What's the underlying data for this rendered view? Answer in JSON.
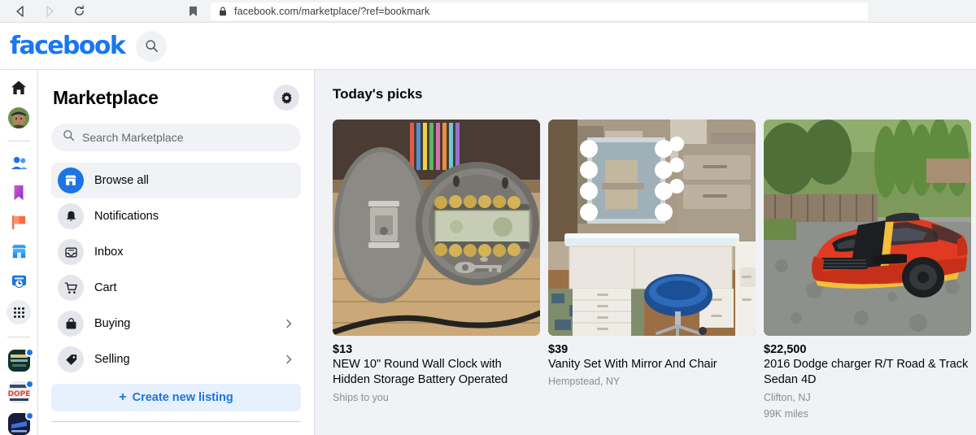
{
  "browser": {
    "back_icon": "back-arrow-icon",
    "forward_icon": "forward-arrow-icon",
    "reload_icon": "reload-icon",
    "bookmark_icon": "bookmark-icon",
    "lock_icon": "lock-icon",
    "url": "facebook.com/marketplace/?ref=bookmark"
  },
  "header": {
    "logo": "facebook",
    "logo_color": "#1877f2",
    "search_icon": "search-icon"
  },
  "rail": {
    "items": [
      {
        "name": "home",
        "icon": "home-icon"
      },
      {
        "name": "profile",
        "icon": "avatar-icon"
      },
      {
        "name": "friends",
        "icon": "friends-icon"
      },
      {
        "name": "saved",
        "icon": "bookmark-saved-icon"
      },
      {
        "name": "pages",
        "icon": "flag-pages-icon"
      },
      {
        "name": "marketplace",
        "icon": "marketplace-store-icon"
      },
      {
        "name": "memories",
        "icon": "memories-clock-icon"
      },
      {
        "name": "see-more",
        "icon": "grid-menu-icon"
      }
    ],
    "groups": [
      {
        "name": "group-1"
      },
      {
        "name": "group-2"
      },
      {
        "name": "group-3"
      }
    ]
  },
  "sidebar": {
    "title": "Marketplace",
    "settings_icon": "gear-icon",
    "search": {
      "placeholder": "Search Marketplace",
      "value": "",
      "icon": "search-icon"
    },
    "nav": [
      {
        "label": "Browse all",
        "icon": "store-icon",
        "active": true,
        "chevron": false
      },
      {
        "label": "Notifications",
        "icon": "bell-icon",
        "active": false,
        "chevron": false
      },
      {
        "label": "Inbox",
        "icon": "inbox-icon",
        "active": false,
        "chevron": false
      },
      {
        "label": "Cart",
        "icon": "cart-icon",
        "active": false,
        "chevron": false
      },
      {
        "label": "Buying",
        "icon": "bag-icon",
        "active": false,
        "chevron": true
      },
      {
        "label": "Selling",
        "icon": "tag-icon",
        "active": false,
        "chevron": true
      }
    ],
    "create_listing": {
      "label": "Create new listing",
      "plus": "+",
      "color": "#1b74e4"
    }
  },
  "main": {
    "section_title": "Today's picks",
    "listings": [
      {
        "price": "$13",
        "title": "NEW 10\" Round Wall Clock with Hidden Storage Battery Operated",
        "meta1": "Ships to you",
        "meta2": "",
        "image": "wall-clock-hidden-safe-photo"
      },
      {
        "price": "$39",
        "title": "Vanity Set With Mirror And Chair",
        "meta1": "Hempstead, NY",
        "meta2": "",
        "image": "vanity-set-mirror-chair-photo"
      },
      {
        "price": "$22,500",
        "title": "2016 Dodge charger R/T Road & Track Sedan 4D",
        "meta1": "Clifton, NJ",
        "meta2": "99K miles",
        "image": "red-dodge-charger-photo"
      }
    ]
  }
}
